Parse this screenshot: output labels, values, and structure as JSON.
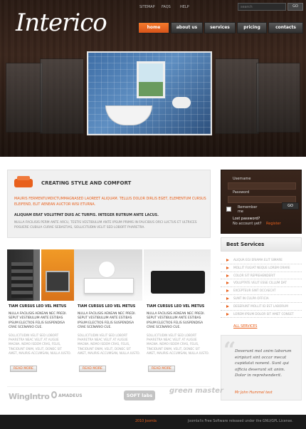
{
  "header": {
    "top_links": [
      "SITEMAP",
      "FAQS",
      "HELP"
    ],
    "search_placeholder": "search",
    "search_button": "GO",
    "logo": "Interico",
    "nav": [
      "home",
      "about us",
      "services",
      "pricing",
      "contacts"
    ],
    "active_nav": "home"
  },
  "intro": {
    "title": "CREATING STYLE AND COMFORT",
    "orange_text": "MAURIS FERMENTUMDICTUMMAGNASED LAOREET ALIQUAM. TELLUS DOLOR DIRLIS EGET, ELEMENTUM CURSUS ELEIFEND, ELIT AENEAN AUCTOR WISI ETURNA.",
    "bold_text": "ALIQUAM ERAT VOLUTPAT DUIS AC TURPIS. INTEGER RUTRUM ANTE LACUS.",
    "body": "NULLA FACILISIS PERM ANTE ARCU, TESTIS VESTIBULUM ANTE IPSUM PRIMIS IN FAUCIBUS ORCI LUCTUS ET ULTRICES POSUERE CUBILIA CURAE SEBASTIAS, SOLLICITUDIN VELIT SED LOBORT PHARETRA."
  },
  "login": {
    "username_label": "Username",
    "password_label": "Password",
    "remember_label": "Remember me",
    "forgot": "Lost password?",
    "no_account": "No account yet?",
    "register": "Register",
    "button": "GO"
  },
  "best_services": {
    "title": "Best Services",
    "items": [
      "ALIQUA EGI ERIAMA ELIT SIMARE",
      "MOLLIT FUGIAT NEQUE LOREM ORARE",
      "COLOR SIT REPREHENDERIT",
      "VOLUPTATE VELIT ESSE CILLUM DAT",
      "EXCEPTEUR SINT OCCAECAT",
      "SUNT IN CULPA OFFICIA",
      "DESERUNT MOLLIT ID EST LABORUM",
      "LOREM IPSUM DOLOR SIT AMET CONSET"
    ],
    "all_link": "ALL SERVICES"
  },
  "quote": {
    "text": "Deserunt mol anim laborum eiripiurt sint occar mecat cupidatat nonent. Sunt qui officia deserunt sit anim. Dolor in reprehenderit.",
    "author": "Mr John Hummel test"
  },
  "columns": [
    {
      "title": "TIAM CURSUS LEO VEL METUS",
      "sub": "NULLA FACILISIS AENEAN NEC PREDI. SEPUT VESTIBULUM ANTE ESTIBAS IPSUM ELECTIOS FELIS SUSPENDISA CRAE SCENARIO CUE.",
      "text": "SOLLICITUDIN VELIT SED LOBORT PHARETRA NEAC VELIT AT AUGUE MAGNA. NEMO ISDEM CRAS, FELIS, TINCIDUNT ENIM, VELIT, DONEC SIT AMET, MAURIS ACCUMSAN, NULLA IUSTO.",
      "more": "READ MORE"
    },
    {
      "title": "TIAM CURSUS LEO VEL METUS",
      "sub": "NULLA FACILISIS AENEAN NEC PREDI. SEPUT VESTIBULUM ANTE ESTIBAS IPSUM ELECTIOS FELIS SUSPENDISA CRAE SCENARIO CUE.",
      "text": "SOLLICITUDIN VELIT SED LOBORT PHARETRA NEAC VELIT AT AUGUE MAGNA. NEMO ISDEM CRAS, FELIS, TINCIDUNT ENIM, VELIT, DONEC SIT AMET, MAURIS ACCUMSAN, NULLA IUSTO.",
      "more": "READ MORE"
    },
    {
      "title": "TIAM CURSUS LEO VEL METUS",
      "sub": "NULLA FACILISIS AENEAN NEC PREDI. SEPUT VESTIBULUM ANTE ESTIBAS IPSUM ELECTIOS FELIS SUSPENDISA CRAE SCENARIO CUE.",
      "text": "SOLLICITUDIN VELIT SED LOBORT PHARETRA NEAC VELIT AT AUGUE MAGNA. NEMO ISDEM CRAS, FELIS, TINCIDUNT ENIM, VELIT, DONEC SIT AMET, MAURIS ACCUMSAN, NULLA IUSTO.",
      "more": "READ MORE"
    }
  ],
  "partners": [
    "WingIntro",
    "AMADEUS",
    "SOFT labs",
    "green master"
  ],
  "footer": {
    "brand": "2010 Joomla",
    "text": "Joomla!is Free Software released under the GNU/GPL License."
  }
}
